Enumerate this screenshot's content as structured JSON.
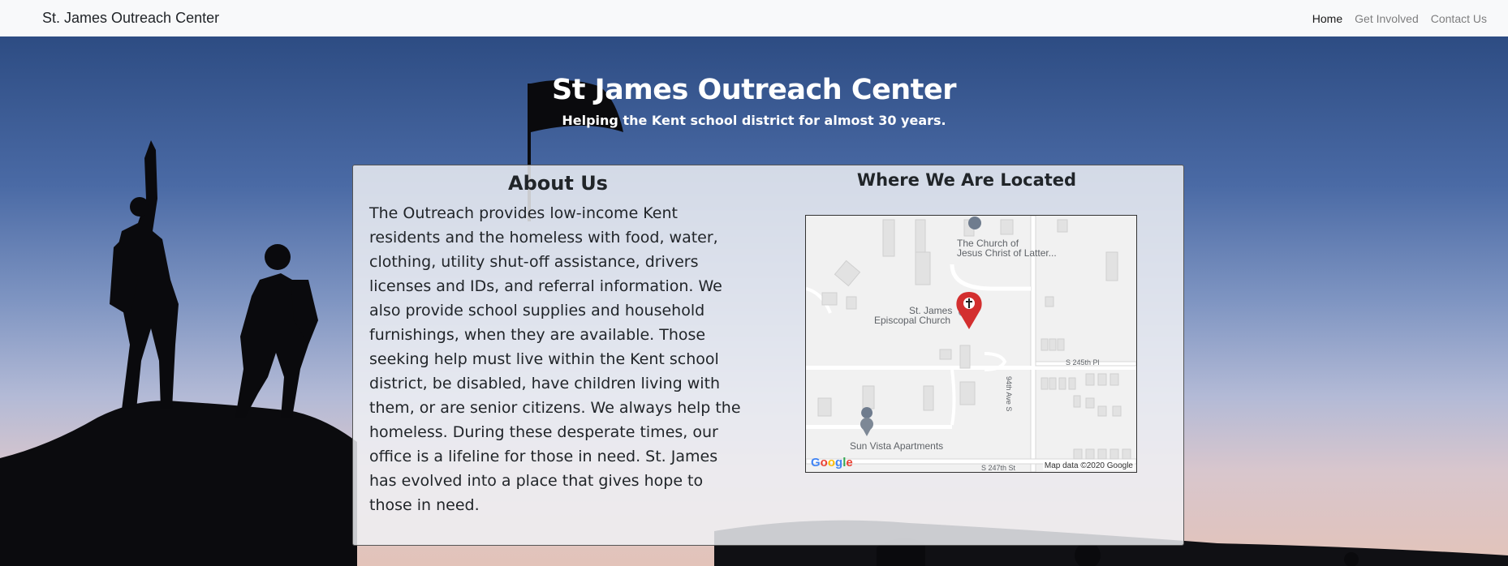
{
  "navbar": {
    "brand": "St. James Outreach Center",
    "links": [
      {
        "label": "Home"
      },
      {
        "label": "Get Involved"
      },
      {
        "label": "Contact Us"
      }
    ]
  },
  "hero": {
    "title": "St James Outreach Center",
    "subtitle": "Helping the Kent school district for almost 30 years."
  },
  "about": {
    "heading": "About Us",
    "body": "The Outreach provides low-income Kent residents and the homeless with food, water, clothing, utility shut-off assistance, drivers licenses and IDs, and referral information. We also provide school supplies and household furnishings, when they are available. Those seeking help must live within the Kent school district, be disabled, have children living with them, or are senior citizens. We always help the homeless. During these desperate times, our office is a lifeline for those in need. St. James has evolved into a place that gives hope to those in need."
  },
  "location": {
    "heading": "Where We Are Located",
    "map": {
      "labels": {
        "church_lds_line1": "The Church of",
        "church_lds_line2": "Jesus Christ of Latter...",
        "stjames_line1": "St. James",
        "stjames_line2": "Episcopal Church",
        "apartments": "Sun Vista Apartments",
        "street_245th": "S 245th Pl",
        "street_94th": "94th Ave S",
        "street_247th": "S 247th St"
      },
      "attribution": "Map data ©2020 Google",
      "logo_letters": [
        "G",
        "o",
        "o",
        "g",
        "l",
        "e"
      ],
      "logo_colors": [
        "#4285F4",
        "#EA4335",
        "#FBBC05",
        "#4285F4",
        "#34A853",
        "#EA4335"
      ],
      "pin_color": "#d32f2f"
    }
  }
}
